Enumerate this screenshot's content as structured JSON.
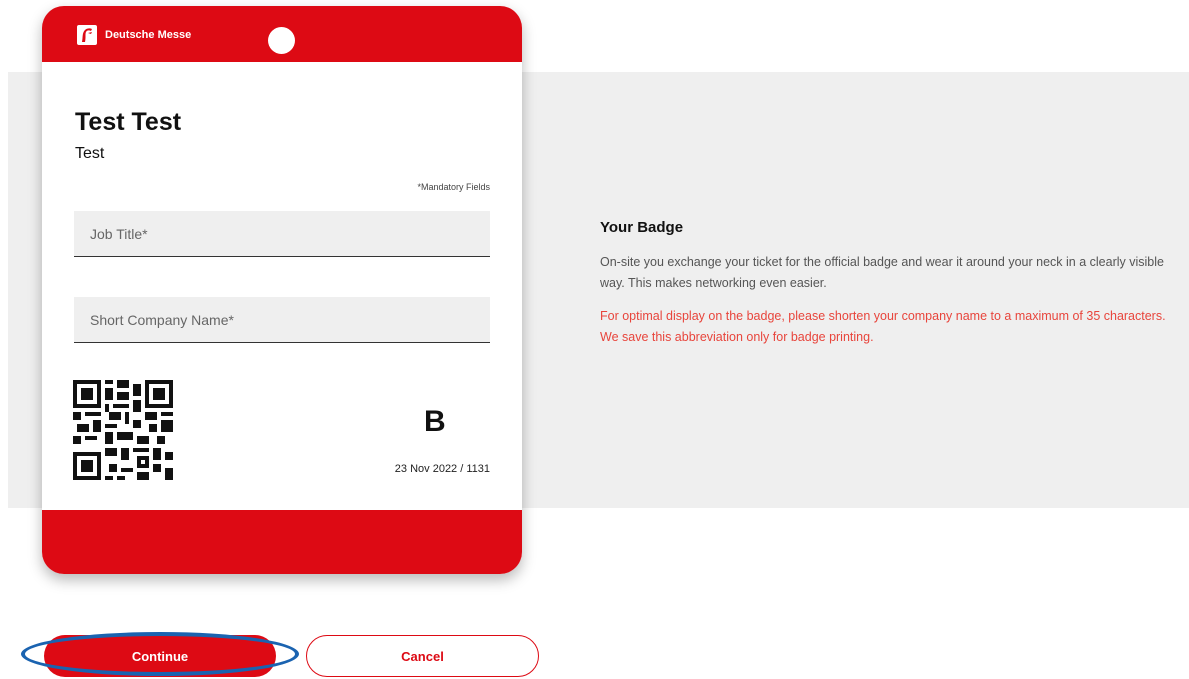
{
  "badge": {
    "brand": "Deutsche Messe",
    "name": "Test Test",
    "company": "Test",
    "mandatory_note": "*Mandatory Fields",
    "job_title_placeholder": "Job Title*",
    "short_company_placeholder": "Short Company Name*",
    "ticket_letter": "B",
    "ticket_date": "23 Nov 2022 / 1131",
    "accent_color": "#dd0a14"
  },
  "info": {
    "title": "Your Badge",
    "text": "On-site you exchange your ticket for the official badge and wear it around your neck in a clearly visible way. This makes networking even easier.",
    "warning": "For optimal display on the badge, please shorten your company name to a maximum of 35 characters. We save this abbreviation only for badge printing.",
    "warning_color": "#e8453c"
  },
  "buttons": {
    "continue_label": "Continue",
    "cancel_label": "Cancel"
  },
  "annotation": {
    "highlight_color": "#1a63b0"
  }
}
